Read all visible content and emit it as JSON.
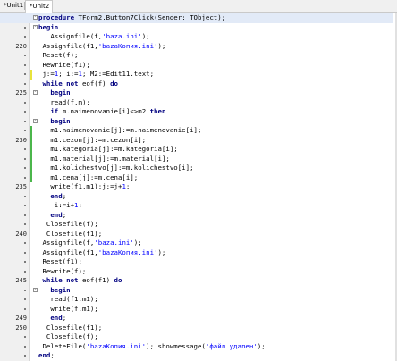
{
  "tabs": [
    {
      "label": "*Unit1",
      "active": false
    },
    {
      "label": "*Unit2",
      "active": true
    }
  ],
  "lines": [
    {
      "num": "",
      "dot": false,
      "mod": "",
      "fold": "-",
      "hl": true,
      "indent": 0,
      "segs": [
        [
          "kw",
          "procedure "
        ],
        [
          "",
          "TForm2.Button7Click(Sender: TObject);"
        ]
      ]
    },
    {
      "num": "",
      "dot": true,
      "mod": "",
      "fold": "-",
      "hl": false,
      "indent": 0,
      "segs": [
        [
          "kw",
          "begin"
        ]
      ]
    },
    {
      "num": "",
      "dot": true,
      "mod": "",
      "fold": "",
      "hl": false,
      "indent": 3,
      "segs": [
        [
          "",
          "Assignfile(f,"
        ],
        [
          "str",
          "'baza.ini'"
        ],
        [
          "",
          ");"
        ]
      ]
    },
    {
      "num": "220",
      "dot": false,
      "mod": "",
      "fold": "",
      "hl": false,
      "indent": 1,
      "segs": [
        [
          "",
          "Assignfile(f1,"
        ],
        [
          "str",
          "'bazaКопия.ini'"
        ],
        [
          "",
          ");"
        ]
      ]
    },
    {
      "num": "",
      "dot": true,
      "mod": "",
      "fold": "",
      "hl": false,
      "indent": 1,
      "segs": [
        [
          "",
          "Reset(f);"
        ]
      ]
    },
    {
      "num": "",
      "dot": true,
      "mod": "",
      "fold": "",
      "hl": false,
      "indent": 1,
      "segs": [
        [
          "",
          "Rewrite(f1);"
        ]
      ]
    },
    {
      "num": "",
      "dot": true,
      "mod": "yellow",
      "fold": "",
      "hl": false,
      "indent": 1,
      "segs": [
        [
          "",
          "j:="
        ],
        [
          "num",
          "1"
        ],
        [
          "",
          "; i:="
        ],
        [
          "num",
          "1"
        ],
        [
          "",
          "; M2:=Edit11.text;"
        ]
      ]
    },
    {
      "num": "",
      "dot": true,
      "mod": "",
      "fold": "",
      "hl": false,
      "indent": 1,
      "segs": [
        [
          "kw",
          "while not "
        ],
        [
          "",
          "eof(f) "
        ],
        [
          "kw",
          "do"
        ]
      ]
    },
    {
      "num": "225",
      "dot": false,
      "mod": "",
      "fold": "-",
      "hl": false,
      "indent": 3,
      "segs": [
        [
          "kw",
          "begin"
        ]
      ]
    },
    {
      "num": "",
      "dot": true,
      "mod": "",
      "fold": "",
      "hl": false,
      "indent": 3,
      "segs": [
        [
          "",
          "read(f,m);"
        ]
      ]
    },
    {
      "num": "",
      "dot": true,
      "mod": "",
      "fold": "",
      "hl": false,
      "indent": 3,
      "segs": [
        [
          "kw",
          "if "
        ],
        [
          "",
          "m.naimenovanie[i]<>m2 "
        ],
        [
          "kw",
          "then"
        ]
      ]
    },
    {
      "num": "",
      "dot": true,
      "mod": "",
      "fold": "-",
      "hl": false,
      "indent": 3,
      "segs": [
        [
          "kw",
          "begin"
        ]
      ]
    },
    {
      "num": "",
      "dot": true,
      "mod": "green",
      "fold": "",
      "hl": false,
      "indent": 3,
      "segs": [
        [
          "",
          "m1.naimenovanie[j]:=m.naimenovanie[i];"
        ]
      ]
    },
    {
      "num": "230",
      "dot": false,
      "mod": "green",
      "fold": "",
      "hl": false,
      "indent": 3,
      "segs": [
        [
          "",
          "m1.cezon[j]:=m.cezon[i];"
        ]
      ]
    },
    {
      "num": "",
      "dot": true,
      "mod": "green",
      "fold": "",
      "hl": false,
      "indent": 3,
      "segs": [
        [
          "",
          "m1.kategoria[j]:=m.kategoria[i];"
        ]
      ]
    },
    {
      "num": "",
      "dot": true,
      "mod": "green",
      "fold": "",
      "hl": false,
      "indent": 3,
      "segs": [
        [
          "",
          "m1.material[j]:=m.material[i];"
        ]
      ]
    },
    {
      "num": "",
      "dot": true,
      "mod": "green",
      "fold": "",
      "hl": false,
      "indent": 3,
      "segs": [
        [
          "",
          "m1.kolichestvo[j]:=m.kolichestvo[i];"
        ]
      ]
    },
    {
      "num": "",
      "dot": true,
      "mod": "green",
      "fold": "",
      "hl": false,
      "indent": 3,
      "segs": [
        [
          "",
          "m1.cena[j]:=m.cena[i];"
        ]
      ]
    },
    {
      "num": "235",
      "dot": false,
      "mod": "",
      "fold": "",
      "hl": false,
      "indent": 3,
      "segs": [
        [
          "",
          "write(f1,m1);j:=j+"
        ],
        [
          "num",
          "1"
        ],
        [
          "",
          ";"
        ]
      ]
    },
    {
      "num": "",
      "dot": true,
      "mod": "",
      "fold": "",
      "hl": false,
      "indent": 3,
      "segs": [
        [
          "kw",
          "end"
        ],
        [
          "",
          ";"
        ]
      ]
    },
    {
      "num": "",
      "dot": true,
      "mod": "",
      "fold": "",
      "hl": false,
      "indent": 4,
      "segs": [
        [
          "",
          "i:=i+"
        ],
        [
          "num",
          "1"
        ],
        [
          "",
          ";"
        ]
      ]
    },
    {
      "num": "",
      "dot": true,
      "mod": "",
      "fold": "",
      "hl": false,
      "indent": 3,
      "segs": [
        [
          "kw",
          "end"
        ],
        [
          "",
          ";"
        ]
      ]
    },
    {
      "num": "",
      "dot": true,
      "mod": "",
      "fold": "",
      "hl": false,
      "indent": 2,
      "segs": [
        [
          "",
          "Closefile(f);"
        ]
      ]
    },
    {
      "num": "240",
      "dot": false,
      "mod": "",
      "fold": "",
      "hl": false,
      "indent": 2,
      "segs": [
        [
          "",
          "Closefile(f1);"
        ]
      ]
    },
    {
      "num": "",
      "dot": true,
      "mod": "",
      "fold": "",
      "hl": false,
      "indent": 1,
      "segs": [
        [
          "",
          "Assignfile(f,"
        ],
        [
          "str",
          "'baza.ini'"
        ],
        [
          "",
          ");"
        ]
      ]
    },
    {
      "num": "",
      "dot": true,
      "mod": "",
      "fold": "",
      "hl": false,
      "indent": 1,
      "segs": [
        [
          "",
          "Assignfile(f1,"
        ],
        [
          "str",
          "'bazaКопия.ini'"
        ],
        [
          "",
          ");"
        ]
      ]
    },
    {
      "num": "",
      "dot": true,
      "mod": "",
      "fold": "",
      "hl": false,
      "indent": 1,
      "segs": [
        [
          "",
          "Reset(f1);"
        ]
      ]
    },
    {
      "num": "",
      "dot": true,
      "mod": "",
      "fold": "",
      "hl": false,
      "indent": 1,
      "segs": [
        [
          "",
          "Rewrite(f);"
        ]
      ]
    },
    {
      "num": "245",
      "dot": false,
      "mod": "",
      "fold": "",
      "hl": false,
      "indent": 1,
      "segs": [
        [
          "kw",
          "while not "
        ],
        [
          "",
          "eof(f1) "
        ],
        [
          "kw",
          "do"
        ]
      ]
    },
    {
      "num": "",
      "dot": true,
      "mod": "",
      "fold": "-",
      "hl": false,
      "indent": 3,
      "segs": [
        [
          "kw",
          "begin"
        ]
      ]
    },
    {
      "num": "",
      "dot": true,
      "mod": "",
      "fold": "",
      "hl": false,
      "indent": 3,
      "segs": [
        [
          "",
          "read(f1,m1);"
        ]
      ]
    },
    {
      "num": "",
      "dot": true,
      "mod": "",
      "fold": "",
      "hl": false,
      "indent": 3,
      "segs": [
        [
          "",
          "write(f,m1);"
        ]
      ]
    },
    {
      "num": "249",
      "dot": false,
      "mod": "",
      "fold": "",
      "hl": false,
      "indent": 3,
      "segs": [
        [
          "kw",
          "end"
        ],
        [
          "",
          ";"
        ]
      ]
    },
    {
      "num": "250",
      "dot": false,
      "mod": "",
      "fold": "",
      "hl": false,
      "indent": 2,
      "segs": [
        [
          "",
          "Closefile(f1);"
        ]
      ]
    },
    {
      "num": "",
      "dot": true,
      "mod": "",
      "fold": "",
      "hl": false,
      "indent": 2,
      "segs": [
        [
          "",
          "Closefile(f);"
        ]
      ]
    },
    {
      "num": "",
      "dot": true,
      "mod": "",
      "fold": "",
      "hl": false,
      "indent": 1,
      "segs": [
        [
          "",
          "DeleteFile("
        ],
        [
          "str",
          "'bazaКопия.ini'"
        ],
        [
          "",
          "); showmessage("
        ],
        [
          "str",
          "'файл удален'"
        ],
        [
          "",
          ");"
        ]
      ]
    },
    {
      "num": "",
      "dot": true,
      "mod": "",
      "fold": "",
      "hl": false,
      "indent": 0,
      "segs": [
        [
          "kw",
          "end"
        ],
        [
          "",
          ";"
        ]
      ]
    }
  ]
}
